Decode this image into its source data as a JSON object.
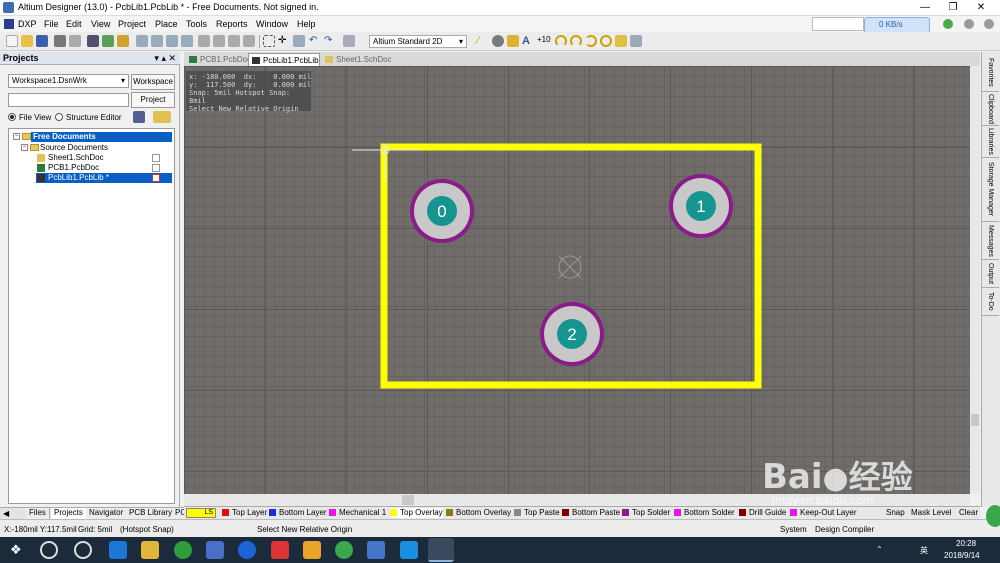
{
  "window": {
    "title": "Altium Designer (13.0) - PcbLib1.PcbLib * - Free Documents. Not signed in."
  },
  "menu": [
    "DXP",
    "File",
    "Edit",
    "View",
    "Project",
    "Place",
    "Tools",
    "Reports",
    "Window",
    "Help"
  ],
  "toolbar": {
    "view_mode": "Altium Standard 2D"
  },
  "network": {
    "speed": "0 KB/s"
  },
  "projects_panel": {
    "title": "Projects",
    "workspace": "Workspace1.DsnWrk",
    "workspace_button": "Workspace",
    "project_button": "Project",
    "file_view": "File View",
    "structure_editor": "Structure Editor",
    "tree": {
      "root": "Free Documents",
      "folder": "Source Documents",
      "items": [
        "Sheet1.SchDoc",
        "PCB1.PcbDoc",
        "PcbLib1.PcbLib *"
      ]
    },
    "tabs": [
      "Files",
      "Projects",
      "Navigator",
      "PCB Library",
      "PC"
    ]
  },
  "doc_tabs": [
    "PCB1.PcbDoc",
    "PcbLib1.PcbLib *",
    "Sheet1.SchDoc"
  ],
  "hud": {
    "line1": "x: -180.000  dx:    0.000 mil",
    "line2": "y:  117.500  dy:    0.000 mil",
    "line3": "Snap: 5mil Hotspot Snap: 8mil",
    "line4": "Select New Relative Origin"
  },
  "pads": [
    {
      "label": "0",
      "shape": "circle"
    },
    {
      "label": "1",
      "shape": "circle"
    },
    {
      "label": "2",
      "shape": "circle"
    }
  ],
  "colors": {
    "outline": "#ffff00",
    "pad_ring": "#8a1c8a",
    "pad_body": "#c8c8c8",
    "pad_hole": "#16948f",
    "canvas": "#6f6c6a"
  },
  "right_tabs": [
    "Favorites",
    "Clipboard",
    "Libraries",
    "Storage Manager",
    "Messages",
    "Output",
    "To-Do"
  ],
  "layers": {
    "ls": "LS",
    "items": [
      {
        "name": "Top Layer",
        "color": "#e01010"
      },
      {
        "name": "Bottom Layer",
        "color": "#1a2ee0"
      },
      {
        "name": "Mechanical 1",
        "color": "#ee10ee"
      },
      {
        "name": "Top Overlay",
        "color": "#ffff00"
      },
      {
        "name": "Bottom Overlay",
        "color": "#8a7a10"
      },
      {
        "name": "Top Paste",
        "color": "#888888"
      },
      {
        "name": "Bottom Paste",
        "color": "#800000"
      },
      {
        "name": "Top Solder",
        "color": "#8a1c8a"
      },
      {
        "name": "Bottom Solder",
        "color": "#ee10ee"
      },
      {
        "name": "Drill Guide",
        "color": "#800000"
      },
      {
        "name": "Keep-Out Layer",
        "color": "#ee10ee"
      }
    ],
    "right": [
      "Snap",
      "Mask Level",
      "Clear"
    ]
  },
  "status": {
    "coords": "X:-180mil Y:117.5mil",
    "grid": "Grid: 5mil",
    "snap": "(Hotspot Snap)",
    "message": "Select New Relative Origin",
    "system": "System",
    "design_compiler": "Design Compiler"
  },
  "taskbar": {
    "time": "20:28",
    "date": "2018/9/14",
    "ime": "英"
  },
  "watermark": {
    "brand": "Bai",
    "brand2": "经验",
    "url": "jingyan.baidu.com"
  }
}
